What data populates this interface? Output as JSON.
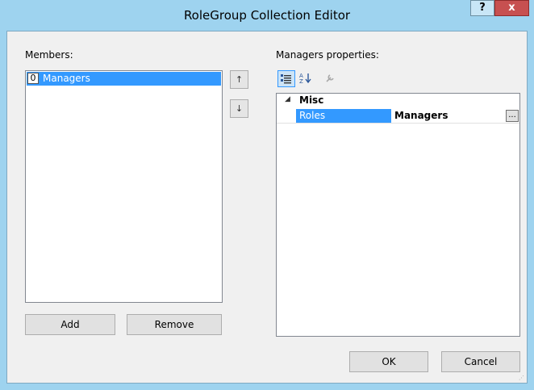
{
  "window": {
    "title": "RoleGroup Collection Editor",
    "help_label": "?",
    "close_label": "x"
  },
  "members": {
    "label": "Members:",
    "items": [
      {
        "index": "0",
        "name": "Managers",
        "selected": true
      }
    ],
    "move_up_icon": "↑",
    "move_down_icon": "↓",
    "add_label": "Add",
    "remove_label": "Remove"
  },
  "properties": {
    "label": "Managers properties:",
    "toolbar": {
      "categorized_icon": "categorized-icon",
      "alphabetical_icon": "alphabetical-icon",
      "property_pages_icon": "wrench-icon"
    },
    "category": {
      "expander": "◢",
      "name": "Misc"
    },
    "rows": [
      {
        "name": "Roles",
        "value": "Managers",
        "button": "..."
      }
    ]
  },
  "footer": {
    "ok_label": "OK",
    "cancel_label": "Cancel"
  },
  "colors": {
    "title_bar": "#9ed3ef",
    "selection": "#3399ff",
    "close": "#c75050"
  }
}
